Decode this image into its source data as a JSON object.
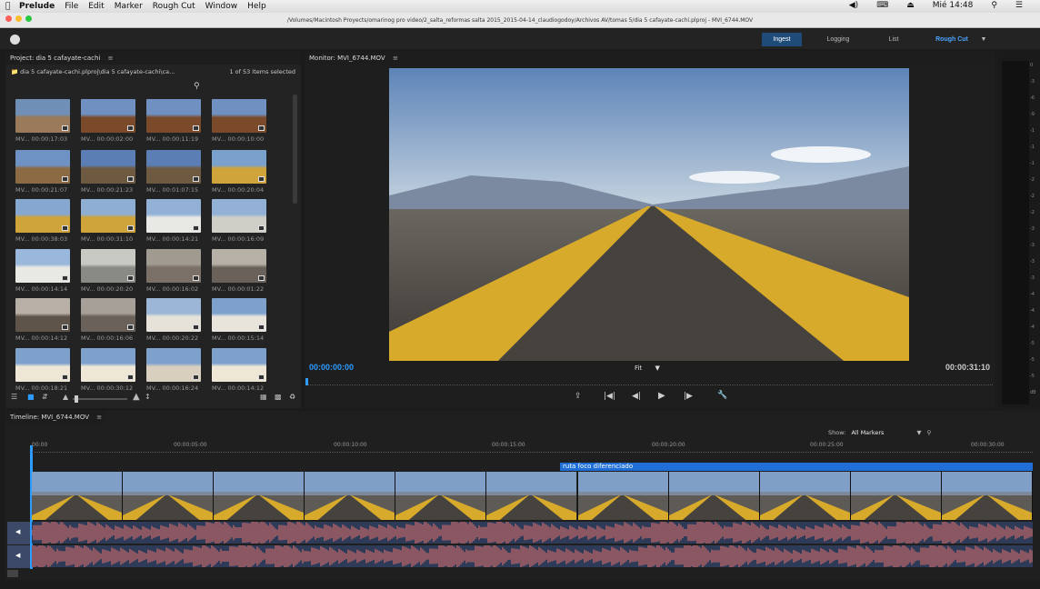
{
  "menubar": {
    "app": "Prelude",
    "items": [
      "File",
      "Edit",
      "Marker",
      "Rough Cut",
      "Window",
      "Help"
    ],
    "clock": "Mié 14:48"
  },
  "titlebar": {
    "path": "/Volumes/Macintosh Proyects/omarinog pro video/2_salta_reformas salta 2015_2015-04-14_claudiogodoy/Archivos AV/tomas 5/dia 5 cafayate-cachi.plproj - MVI_6744.MOV"
  },
  "workspaces": [
    {
      "label": "Ingest",
      "active": true
    },
    {
      "label": "Logging",
      "active": false
    },
    {
      "label": "List",
      "active": false
    },
    {
      "label": "Rough Cut",
      "active": false
    }
  ],
  "project": {
    "title": "Project: dia 5 cafayate-cachi",
    "path": "dia 5 cafayate-cachi.plproj\\dia 5 cafayate-cachi\\ca...",
    "selection": "1 of 53 Items selected",
    "clips": [
      {
        "label": "MV...",
        "time": "00:00:17:03"
      },
      {
        "label": "MV...",
        "time": "00:00:02:00"
      },
      {
        "label": "MV...",
        "time": "00:00:11:19"
      },
      {
        "label": "MV...",
        "time": "00:00:10:00"
      },
      {
        "label": "MV...",
        "time": "00:00:21:07"
      },
      {
        "label": "MV...",
        "time": "00:00:21:23"
      },
      {
        "label": "MV...",
        "time": "00:01:07:15"
      },
      {
        "label": "MV...",
        "time": "00:00:20:04"
      },
      {
        "label": "MV...",
        "time": "00:00:38:03"
      },
      {
        "label": "MV...",
        "time": "00:00:31:10"
      },
      {
        "label": "MV...",
        "time": "00:00:14:21"
      },
      {
        "label": "MV...",
        "time": "00:00:16:09"
      },
      {
        "label": "MV...",
        "time": "00:00:14:14"
      },
      {
        "label": "MV...",
        "time": "00:00:20:20"
      },
      {
        "label": "MV...",
        "time": "00:00:16:02"
      },
      {
        "label": "MV...",
        "time": "00:00:01:22"
      },
      {
        "label": "MV...",
        "time": "00:00:14:12"
      },
      {
        "label": "MV...",
        "time": "00:00:16:06"
      },
      {
        "label": "MV...",
        "time": "00:00:20:22"
      },
      {
        "label": "MV...",
        "time": "00:00:15:14"
      },
      {
        "label": "MV...",
        "time": "00:00:18:21"
      },
      {
        "label": "MV...",
        "time": "00:00:30:12"
      },
      {
        "label": "MV...",
        "time": "00:00:16:24"
      },
      {
        "label": "MV...",
        "time": "00:00:14:12"
      }
    ]
  },
  "monitor": {
    "title": "Monitor: MVI_6744.MOV",
    "current_time": "00:00:00:00",
    "duration": "00:00:31:10",
    "fit": "Fit"
  },
  "audio_meter": {
    "scale": [
      "0",
      "-3",
      "-6",
      "-9",
      "-1",
      "-1",
      "-1",
      "-2",
      "-2",
      "-2",
      "-3",
      "-3",
      "-3",
      "-3",
      "-4",
      "-4",
      "-4",
      "-5",
      "-5",
      "-5",
      "dB"
    ]
  },
  "timeline": {
    "title": "Timeline: MVI_6744.MOV",
    "show_label": "Show:",
    "show_value": "All Markers",
    "ticks": [
      "00:00",
      "00:00:05:00",
      "00:00:10:00",
      "00:00:15:00",
      "00:00:20:00",
      "00:00:25:00",
      "00:00:30:00"
    ],
    "marker": "ruta foco diferenciado"
  },
  "colors": {
    "accent": "#2d9cff",
    "workspace_active": "#1e4b78",
    "marker": "#1f6fd6",
    "audio_bg": "#2e3b58",
    "waveform": "#c86a6a"
  }
}
